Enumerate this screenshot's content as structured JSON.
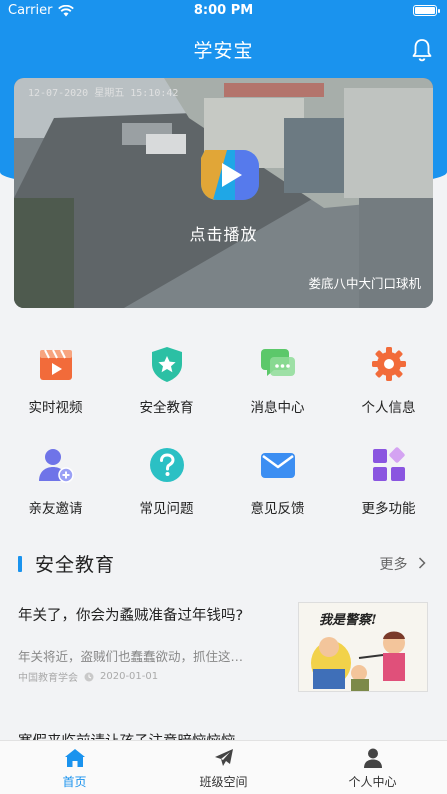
{
  "status": {
    "carrier": "Carrier",
    "time": "8:00 PM"
  },
  "header": {
    "title": "学安宝"
  },
  "video": {
    "timestamp": "12-07-2020  星期五  15:10:42",
    "play_label": "点击播放",
    "camera_name": "娄底八中大门口球机"
  },
  "menu": [
    {
      "label": "实时视频",
      "icon": "clapperboard-icon",
      "color": "#f26b3a"
    },
    {
      "label": "安全教育",
      "icon": "shield-star-icon",
      "color": "#2bc0a4"
    },
    {
      "label": "消息中心",
      "icon": "chat-bubbles-icon",
      "color": "#5cc86a"
    },
    {
      "label": "个人信息",
      "icon": "gear-icon",
      "color": "#f26b3a"
    },
    {
      "label": "亲友邀请",
      "icon": "add-user-icon",
      "color": "#6f74e8"
    },
    {
      "label": "常见问题",
      "icon": "question-icon",
      "color": "#2bc0c4"
    },
    {
      "label": "意见反馈",
      "icon": "mail-icon",
      "color": "#3c8ef2"
    },
    {
      "label": "更多功能",
      "icon": "apps-grid-icon",
      "color": "#8a55e0"
    }
  ],
  "section": {
    "title": "安全教育",
    "more": "更多"
  },
  "articles": [
    {
      "title": "年关了，你会为蟊贼准备过年钱吗?",
      "desc": "年关将近，盗贼们也蠢蠢欲动，抓住这…",
      "source": "中国教育学会",
      "date": "2020-01-01",
      "thumb_text": "我是警察!"
    },
    {
      "title": "寒假来临前请让孩子注意暗恼恼恼"
    }
  ],
  "tabs": [
    {
      "label": "首页",
      "icon": "home-icon",
      "active": true
    },
    {
      "label": "班级空间",
      "icon": "paper-plane-icon",
      "active": false
    },
    {
      "label": "个人中心",
      "icon": "person-icon",
      "active": false
    }
  ],
  "colors": {
    "primary": "#1a93ee",
    "background": "#f2f3f5"
  }
}
